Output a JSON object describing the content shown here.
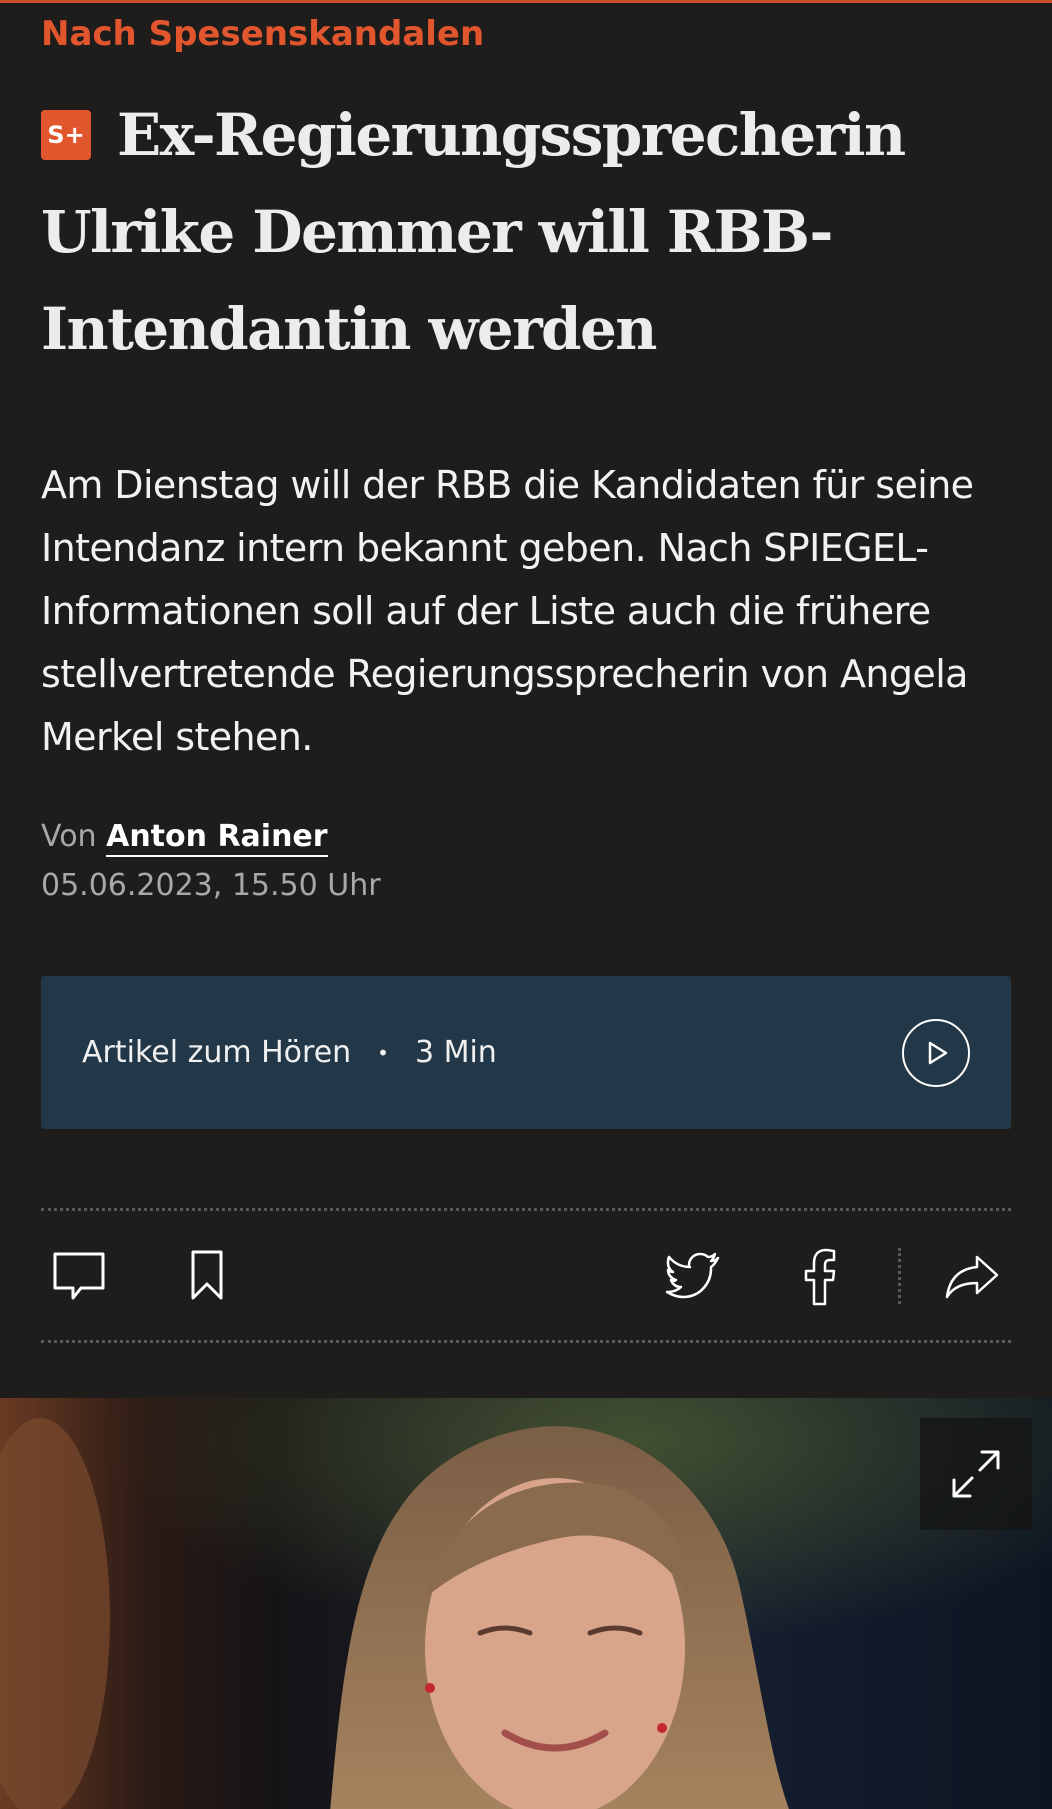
{
  "article": {
    "kicker": "Nach Spesenskandalen",
    "badge": "S+",
    "headline": "Ex-Regierungssprecherin Ulrike Demmer will RBB-Intendantin werden",
    "teaser": "Am Dienstag will der RBB die Kandidaten für seine Intendanz intern bekannt geben. Nach SPIEGEL-Informationen soll auf der Liste auch die frühere stellvertretende Regierungssprecherin von Angela Merkel stehen.",
    "byline_prefix": "Von",
    "author": "Anton Rainer",
    "date": "05.06.2023, 15.50 Uhr"
  },
  "audio": {
    "label": "Artikel zum Hören",
    "separator": "•",
    "duration": "3 Min",
    "icon": "play-icon"
  },
  "toolbar": {
    "icons": [
      "comment-icon",
      "bookmark-icon",
      "twitter-icon",
      "facebook-icon",
      "share-icon"
    ]
  },
  "photo": {
    "icon": "expand-icon"
  },
  "colors": {
    "background": "#1e1d1c",
    "accent": "#e2562e",
    "audio_bar": "#223747",
    "text": "#eeeeee",
    "muted": "#a8a8a8"
  }
}
